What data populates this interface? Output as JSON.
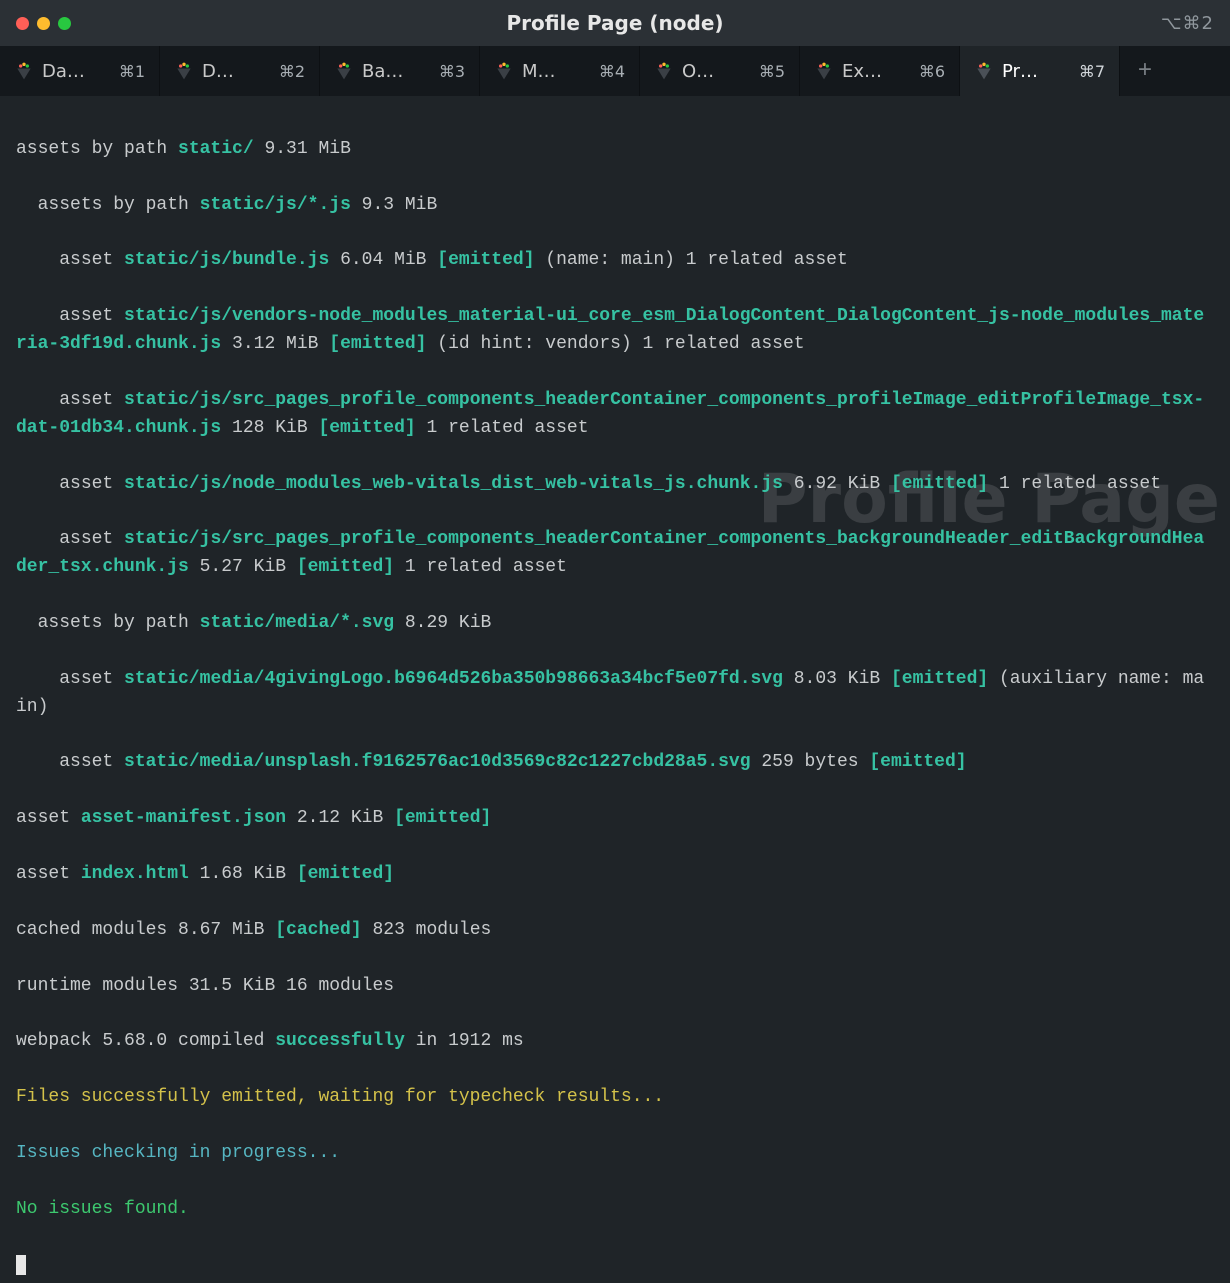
{
  "title": "Profile Page (node)",
  "title_right_shortcut": "⌥⌘2",
  "tabs": [
    {
      "label": "Da…",
      "shortcut": "⌘1",
      "active": false
    },
    {
      "label": "D…",
      "shortcut": "⌘2",
      "active": false
    },
    {
      "label": "Ba…",
      "shortcut": "⌘3",
      "active": false
    },
    {
      "label": "M…",
      "shortcut": "⌘4",
      "active": false
    },
    {
      "label": "O…",
      "shortcut": "⌘5",
      "active": false
    },
    {
      "label": "Ex…",
      "shortcut": "⌘6",
      "active": false
    },
    {
      "label": "Pr…",
      "shortcut": "⌘7",
      "active": true
    }
  ],
  "watermark": "Profile Page",
  "term": {
    "l01a": "assets by path ",
    "l01b": "static/",
    "l01c": " 9.31 MiB",
    "l02a": "  assets by path ",
    "l02b": "static/js/*.js",
    "l02c": " 9.3 MiB",
    "l03a": "    asset ",
    "l03b": "static/js/bundle.js",
    "l03c": " 6.04 MiB ",
    "l03d": "[emitted]",
    "l03e": " (name: main) 1 related asset",
    "l04a": "    asset ",
    "l04b": "static/js/vendors-node_modules_material-ui_core_esm_DialogContent_DialogContent_js-node_modules_materia-3df19d.chunk.js",
    "l04c": " 3.12 MiB ",
    "l04d": "[emitted]",
    "l04e": " (id hint: vendors) 1 related asset",
    "l05a": "    asset ",
    "l05b": "static/js/src_pages_profile_components_headerContainer_components_profileImage_editProfileImage_tsx-dat-01db34.chunk.js",
    "l05c": " 128 KiB ",
    "l05d": "[emitted]",
    "l05e": " 1 related asset",
    "l06a": "    asset ",
    "l06b": "static/js/node_modules_web-vitals_dist_web-vitals_js.chunk.js",
    "l06c": " 6.92 KiB ",
    "l06d": "[emitted]",
    "l06e": " 1 related asset",
    "l07a": "    asset ",
    "l07b": "static/js/src_pages_profile_components_headerContainer_components_backgroundHeader_editBackgroundHeader_tsx.chunk.js",
    "l07c": " 5.27 KiB ",
    "l07d": "[emitted]",
    "l07e": " 1 related asset",
    "l08a": "  assets by path ",
    "l08b": "static/media/*.svg",
    "l08c": " 8.29 KiB",
    "l09a": "    asset ",
    "l09b": "static/media/4givingLogo.b6964d526ba350b98663a34bcf5e07fd.svg",
    "l09c": " 8.03 KiB ",
    "l09d": "[emitted]",
    "l09e": " (auxiliary name: main)",
    "l10a": "    asset ",
    "l10b": "static/media/unsplash.f9162576ac10d3569c82c1227cbd28a5.svg",
    "l10c": " 259 bytes ",
    "l10d": "[emitted]",
    "l11a": "asset ",
    "l11b": "asset-manifest.json",
    "l11c": " 2.12 KiB ",
    "l11d": "[emitted]",
    "l12a": "asset ",
    "l12b": "index.html",
    "l12c": " 1.68 KiB ",
    "l12d": "[emitted]",
    "l13a": "cached modules 8.67 MiB ",
    "l13b": "[cached]",
    "l13c": " 823 modules",
    "l14": "runtime modules 31.5 KiB 16 modules",
    "l15a": "webpack 5.68.0 compiled ",
    "l15b": "successfully",
    "l15c": " in 1912 ms",
    "l16": "Files successfully emitted, waiting for typecheck results...",
    "l17": "Issues checking in progress...",
    "l18": "No issues found."
  }
}
